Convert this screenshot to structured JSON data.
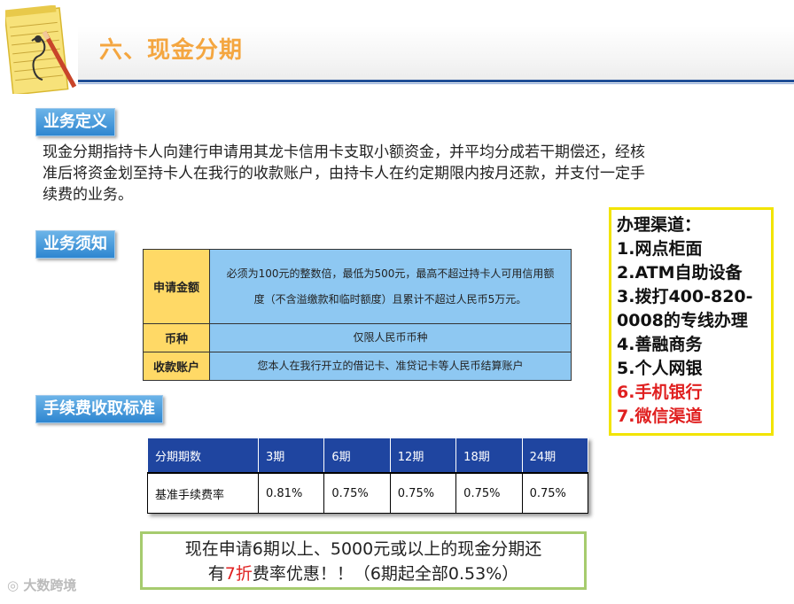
{
  "page": {
    "title": "六、现金分期"
  },
  "sections": {
    "definition_tag": "业务定义",
    "notice_tag": "业务须知",
    "fee_tag": "手续费收取标准"
  },
  "definition": {
    "line1": "现金分期指持卡人向建行申请用其龙卡信用卡支取小额资金，并平均分成若干期偿还，经核",
    "line2": "准后将资金划至持卡人在我行的收款账户，由持卡人在约定期限内按月还款，并支付一定手",
    "line3": "续费的业务。"
  },
  "rules": [
    {
      "label": "申请金额",
      "value_line1": "必须为100元的整数倍，最低为500元，最高不超过持卡人可用信用额",
      "value_line2": "度（不含溢缴款和临时额度）且累计不超过人民币5万元。"
    },
    {
      "label": "币种",
      "value_line1": "仅限人民币币种",
      "value_line2": ""
    },
    {
      "label": "收款账户",
      "value_line1": "您本人在我行开立的借记卡、准贷记卡等人民币结算账户",
      "value_line2": ""
    }
  ],
  "fee_table": {
    "headers": [
      "分期期数",
      "3期",
      "6期",
      "12期",
      "18期",
      "24期"
    ],
    "row": [
      "基准手续费率",
      "0.81%",
      "0.75%",
      "0.75%",
      "0.75%",
      "0.75%"
    ]
  },
  "channels": {
    "title": "办理渠道：",
    "items": [
      "1.网点柜面",
      "2.ATM自助设备",
      "3.拨打400-820-",
      "0008的专线办理",
      "4.善融商务",
      "5.个人网银",
      "6.手机银行",
      "7.微信渠道"
    ]
  },
  "promo": {
    "line1": "现在申请6期以上、5000元或以上的现金分期还",
    "line2_pre": "有",
    "line2_highlight": "7折",
    "line2_post": "费率优惠！！（6期起全部0.53%）"
  },
  "watermark": "大数跨境",
  "colors": {
    "title": "#f4a640",
    "tag": "#2e86d0",
    "table_header": "#1f45a0",
    "rules_bg": "#8ec8f2",
    "rules_label_bg": "#ffd966",
    "channels_border": "#f2e400",
    "promo_border": "#a6cb6e",
    "highlight_red": "#e02020"
  }
}
